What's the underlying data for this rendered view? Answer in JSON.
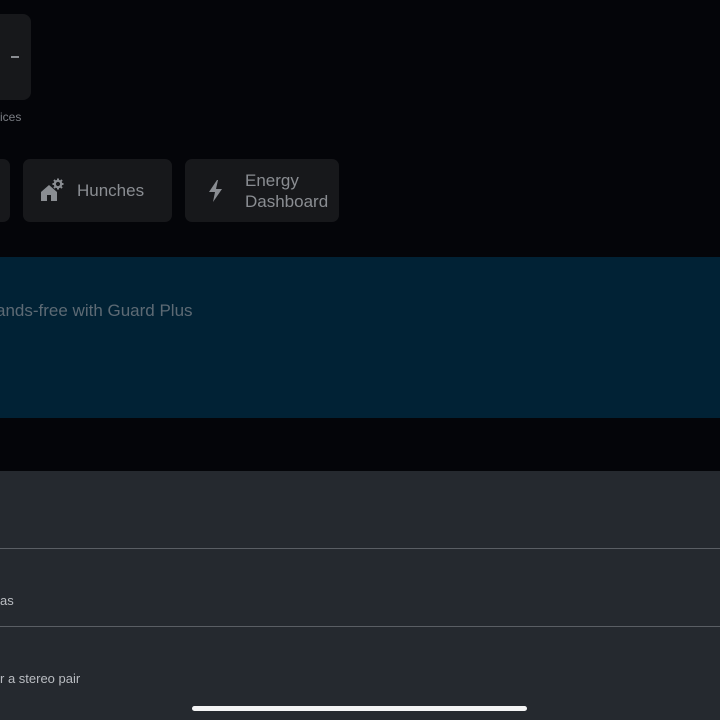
{
  "shortcuts": {
    "devices_label": "vices",
    "hunches_label": "Hunches",
    "energy_label": "Energy Dashboard"
  },
  "banner": {
    "text": "ands-free with Guard Plus"
  },
  "list": {
    "items": [
      {
        "label": ""
      },
      {
        "label": "as"
      },
      {
        "label": "r a stereo pair"
      }
    ]
  },
  "colors": {
    "background": "#040509",
    "tile": "#17181b",
    "banner": "#012235",
    "list_bg": "#25292f",
    "divider": "#5a5e64"
  }
}
